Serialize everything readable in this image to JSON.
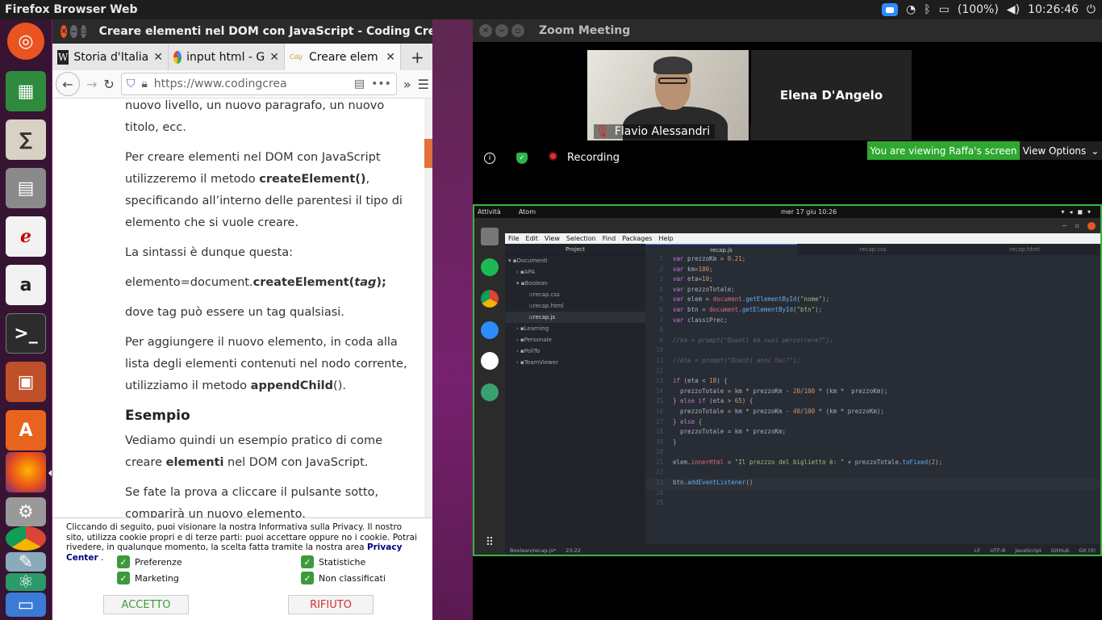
{
  "topbar": {
    "app_title": "Firefox Browser Web",
    "battery": "(100%)",
    "clock": "10:26:46"
  },
  "launcher": {
    "items": [
      "ubuntu-logo",
      "calc",
      "math",
      "file-cabinet",
      "document-viewer",
      "amazon",
      "terminal",
      "impress",
      "software",
      "firefox",
      "settings",
      "chrome",
      "text-editor",
      "atom",
      "files"
    ]
  },
  "firefox": {
    "window_title": "Creare elementi nel DOM con JavaScript - Coding Crea",
    "tabs": [
      {
        "label": "Storia d'Italia",
        "icon": "W"
      },
      {
        "label": "input html - G",
        "icon": "G"
      },
      {
        "label": "Creare elem",
        "icon": "coding"
      }
    ],
    "url": "https://www.codingcrea",
    "article": {
      "p0": "nuovo livello, un nuovo paragrafo, un nuovo titolo, ecc.",
      "p1a": "Per creare elementi nel DOM con JavaScript utilizzeremo il metodo ",
      "p1b": "createElement()",
      "p1c": ", specificando all’interno delle parentesi il tipo di elemento che si vuole creare.",
      "p2": "La sintassi è dunque questa:",
      "p3a": "elemento=document.",
      "p3b": "createElement(",
      "p3c": "tag",
      "p3d": ");",
      "p4": "dove tag può essere un tag qualsiasi.",
      "p5a": "Per aggiungere il nuovo elemento, in coda alla lista degli elementi contenuti nel nodo corrente, utilizziamo il metodo ",
      "p5b": "appendChild",
      "p5c": "().",
      "h_esempio": "Esempio",
      "p6a": "Vediamo quindi un esempio pratico di come creare ",
      "p6b": "elementi",
      "p6c": " nel DOM con JavaScript.",
      "p7": "Se fate la prova a cliccare il pulsante sotto, comparirà un nuovo elemento."
    },
    "cookie": {
      "text": "Cliccando di seguito, puoi visionare la nostra Informativa sulla Privacy. Il nostro sito, utilizza cookie propri e di terze parti: puoi accettare oppure no i cookie. Potrai rivedere, in qualunque momento, la scelta fatta tramite la nostra area ",
      "link": "Privacy Center",
      "end": " .",
      "checks": [
        "Preferenze",
        "Statistiche",
        "Marketing",
        "Non classificati"
      ],
      "accept": "ACCETTO",
      "reject": "RIFIUTO"
    }
  },
  "zoom": {
    "window_title": "Zoom Meeting",
    "participant1": "Flavio Alessandri",
    "participant2": "Elena D'Angelo",
    "recording": "Recording",
    "viewing": "You are viewing Raffa's screen",
    "view_options": "View Options",
    "shared": {
      "activities": "Attività",
      "app": "Atom",
      "date": "mer 17 giu  10:26",
      "menu": [
        "File",
        "Edit",
        "View",
        "Selection",
        "Find",
        "Packages",
        "Help"
      ],
      "project_header": "Project",
      "tree": [
        "Documenti",
        "APA",
        "Boolean",
        "recap.css",
        "recap.html",
        "recap.js",
        "Learning",
        "Personale",
        "PoliTo",
        "TeamViewer"
      ],
      "tabs": [
        "recap.js",
        "recap.css",
        "recap.html"
      ],
      "code": [
        "var prezzoKm = 0.21;",
        "var km=100;",
        "var eta=10;",
        "var prezzoTotale;",
        "var elem = document.getElementById(\"nome\");",
        "var btn = document.getElementById(\"btn\");",
        "var classiPrec;",
        "",
        "//km = prompt(\"Quanti km vuoi percorrere?\");",
        "",
        "//eta = prompt(\"Quanti anni hai?\");",
        "",
        "if (eta < 18) {",
        "  prezzoTotale = km * prezzoKm - 20/100 * (km *  prezzoKm);",
        "} else if (eta > 65) {",
        "  prezzoTotale = km * prezzoKm - 40/100 * (km * prezzoKm);",
        "} else {",
        "  prezzoTotale = km * prezzoKm;",
        "}",
        "",
        "elem.innerHtml = \"Il prezzzo del biglietto è: \" + prezzoTotale.toFixed(2);",
        "",
        "btn.addEventListener()",
        "",
        ""
      ],
      "status_left": "Boolean/recap.js*",
      "status_pos": "23:22",
      "status_right": [
        "LF",
        "UTF-8",
        "JavaScript",
        "GitHub",
        "Git (0)"
      ]
    }
  },
  "colors": {
    "accent": "#e95420",
    "zoom_green": "#2fa82f",
    "purple": "#77216f"
  }
}
